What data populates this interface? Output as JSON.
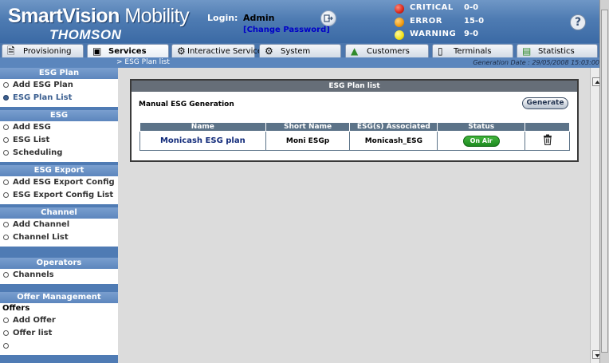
{
  "header": {
    "logo_smart": "SmartVision",
    "logo_mobility": "Mobility",
    "logo_thomson": "THOMSON",
    "login_label": "Login:",
    "username": "Admin",
    "change_password": "[Change Password]",
    "alarms": [
      {
        "label": "CRITICAL",
        "value": "0-0",
        "color": "#d8261a"
      },
      {
        "label": "ERROR",
        "value": "15-0",
        "color": "#f09a10"
      },
      {
        "label": "WARNING",
        "value": "9-0",
        "color": "#f2e21a"
      }
    ]
  },
  "tabs": [
    {
      "label": "Provisioning",
      "icon": "document-icon"
    },
    {
      "label": "Services",
      "icon": "monitor-icon",
      "active": true
    },
    {
      "label": "Interactive Services",
      "icon": "interactive-icon"
    },
    {
      "label": "System",
      "icon": "gears-icon"
    },
    {
      "label": "Customers",
      "icon": "person-icon"
    },
    {
      "label": "Terminals",
      "icon": "phone-icon"
    },
    {
      "label": "Statistics",
      "icon": "chart-icon"
    }
  ],
  "breadcrumb": "> ESG Plan list",
  "generation_date": "Generation Date : 29/05/2008 15:03:00",
  "sidebar": {
    "sections": [
      {
        "title": "ESG Plan",
        "items": [
          "Add ESG Plan",
          "ESG Plan List"
        ]
      },
      {
        "title": "ESG",
        "items": [
          "Add ESG",
          "ESG List",
          "Scheduling"
        ]
      },
      {
        "title": "ESG Export",
        "items": [
          "Add ESG Export Config",
          "ESG Export Config List"
        ]
      },
      {
        "title": "Channel",
        "items": [
          "Add Channel",
          "Channel List"
        ]
      },
      {
        "title": "Operators",
        "items": [
          "Channels"
        ]
      },
      {
        "title": "Offer Management",
        "subtitle": "Offers",
        "items": [
          "Add Offer",
          "Offer list"
        ]
      }
    ],
    "selected": "ESG Plan List"
  },
  "panel": {
    "title": "ESG Plan list",
    "manual_title": "Manual ESG Generation",
    "generate_label": "Generate",
    "columns": [
      "Name",
      "Short Name",
      "ESG(s) Associated",
      "Status",
      ""
    ],
    "rows": [
      {
        "name": "Monicash ESG plan",
        "short_name": "Moni ESGp",
        "esg": "Monicash_ESG",
        "status": "On Air"
      }
    ]
  }
}
